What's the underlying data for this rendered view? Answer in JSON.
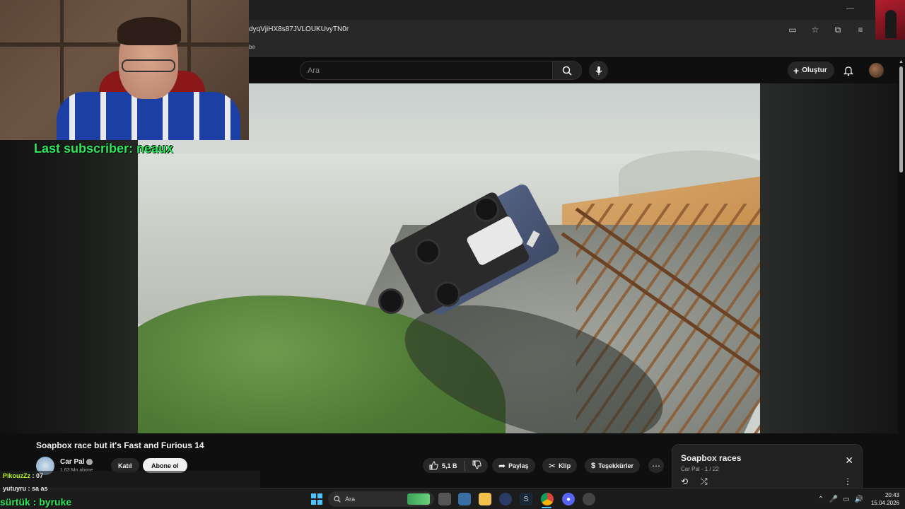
{
  "browser": {
    "url": "dyqVjiHX8s87JVLOUKUvyTN0r",
    "bookmark_label": "be"
  },
  "youtube_header": {
    "search_placeholder": "Ara",
    "create_label": "Oluştur"
  },
  "overlay": {
    "last_subscriber": "Last subscriber: neaux"
  },
  "video": {
    "title": "Soapbox race but it's Fast and Furious 14",
    "channel_name": "Car Pal",
    "channel_subs": "1,63 Mn abone",
    "join_label": "Katıl",
    "subscribe_label": "Abone ol",
    "like_count": "5,1 B",
    "share_label": "Paylaş",
    "clip_label": "Klip",
    "thanks_label": "Teşekkürler"
  },
  "playlist": {
    "title": "Soapbox races",
    "subtitle": "Car Pal - 1 / 22"
  },
  "chat": {
    "msg1_user": "PikouzZz",
    "msg1_text": " : 07",
    "msg2_user": "yutuyru",
    "msg2_text": " : sa as",
    "msg3": "sürtük : byruke"
  },
  "taskbar": {
    "search_label": "Ara",
    "time": "20:43",
    "date": "15.04.2026"
  },
  "colors": {
    "subscriber_green": "#2ee85a",
    "accent_blue": "#4cc2ff",
    "youtube_bg": "#0f0f0f"
  }
}
